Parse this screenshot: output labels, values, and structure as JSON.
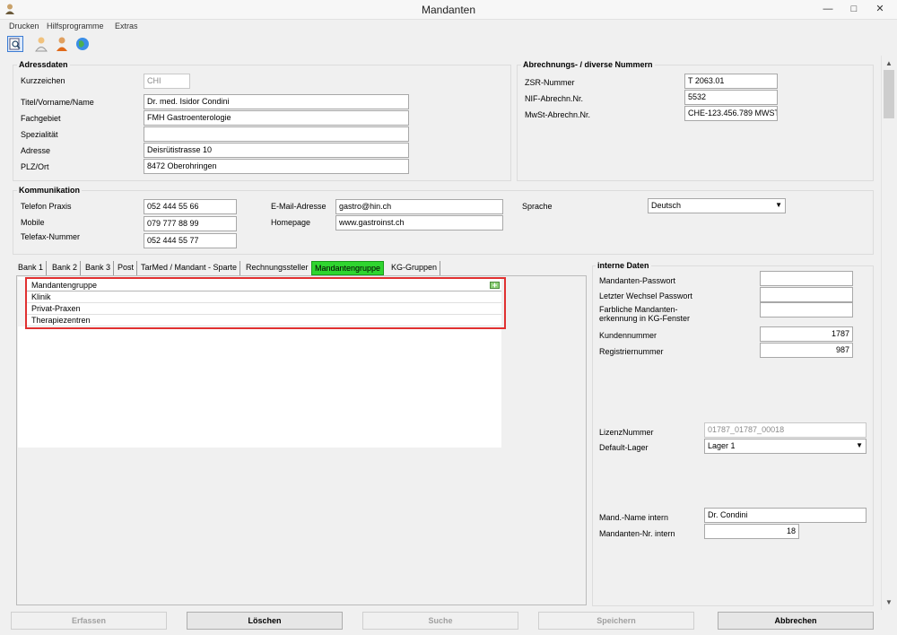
{
  "window": {
    "title": "Mandanten",
    "app_icon": "person-icon"
  },
  "menu": [
    "Drucken",
    "Hilfsprogramme",
    "Extras"
  ],
  "toolbar": [
    {
      "name": "search-icon"
    },
    {
      "name": "user-icon"
    },
    {
      "name": "user-orange-icon"
    },
    {
      "name": "globe-icon"
    }
  ],
  "adressdaten": {
    "title": "Adressdaten",
    "kurzzeichen_label": "Kurzzeichen",
    "kurzzeichen": "CHI",
    "titel_label": "Titel/Vorname/Name",
    "titel": "Dr. med. Isidor Condini",
    "fachgebiet_label": "Fachgebiet",
    "fachgebiet": "FMH Gastroenterologie",
    "spezialitaet_label": "Spezialität",
    "spezialitaet": "",
    "adresse_label": "Adresse",
    "adresse": "Deisrütistrasse 10",
    "plz_label": "PLZ/Ort",
    "plz": "8472 Oberohringen"
  },
  "nummern": {
    "title": "Abrechnungs- / diverse Nummern",
    "zsr_label": "ZSR-Nummer",
    "zsr": "T 2063.01",
    "nif_label": "NIF-Abrechn.Nr.",
    "nif": "5532",
    "mwst_label": "MwSt-Abrechn.Nr.",
    "mwst": "CHE-123.456.789 MWST"
  },
  "kommunikation": {
    "title": "Kommunikation",
    "telefon_label": "Telefon Praxis",
    "telefon": "052 444 55 66",
    "mobile_label": "Mobile",
    "mobile": "079 777 88 99",
    "telefax_label": "Telefax-Nummer",
    "telefax": "052 444 55 77",
    "email_label": "E-Mail-Adresse",
    "email": "gastro@hin.ch",
    "homepage_label": "Homepage",
    "homepage": "www.gastroinst.ch",
    "sprache_label": "Sprache",
    "sprache": "Deutsch"
  },
  "tabs": [
    "Bank 1",
    "Bank 2",
    "Bank 3",
    "Post",
    "TarMed / Mandant - Sparte",
    "Rechnungssteller",
    "Mandantengruppe",
    "KG-Gruppen"
  ],
  "active_tab": "Mandantengruppe",
  "grid": {
    "header": "Mandantengruppe",
    "rows": [
      "Klinik",
      "Privat-Praxen",
      "Therapiezentren"
    ]
  },
  "intern": {
    "title": "interne Daten",
    "passwort_label": "Mandanten-Passwort",
    "passwort": "",
    "wechsel_label": "Letzter Wechsel Passwort",
    "wechsel": "",
    "farb_label_1": "Farbliche Mandanten-",
    "farb_label_2": "erkennung in KG-Fenster",
    "farb": "",
    "kunden_label": "Kundennummer",
    "kunden": "1787",
    "register_label": "Registriernummer",
    "register": "987",
    "lizenz_label": "LizenzNummer",
    "lizenz": "01787_01787_00018",
    "lager_label": "Default-Lager",
    "lager": "Lager 1",
    "mandname_label": "Mand.-Name intern",
    "mandname": "Dr. Condini",
    "mandnr_label": "Mandanten-Nr. intern",
    "mandnr": "18"
  },
  "buttons": {
    "erfassen": "Erfassen",
    "loeschen": "Löschen",
    "suche": "Suche",
    "speichern": "Speichern",
    "abbrechen": "Abbrechen"
  },
  "colors": {
    "active_tab": "#2fd52f",
    "highlight": "#e03030"
  }
}
